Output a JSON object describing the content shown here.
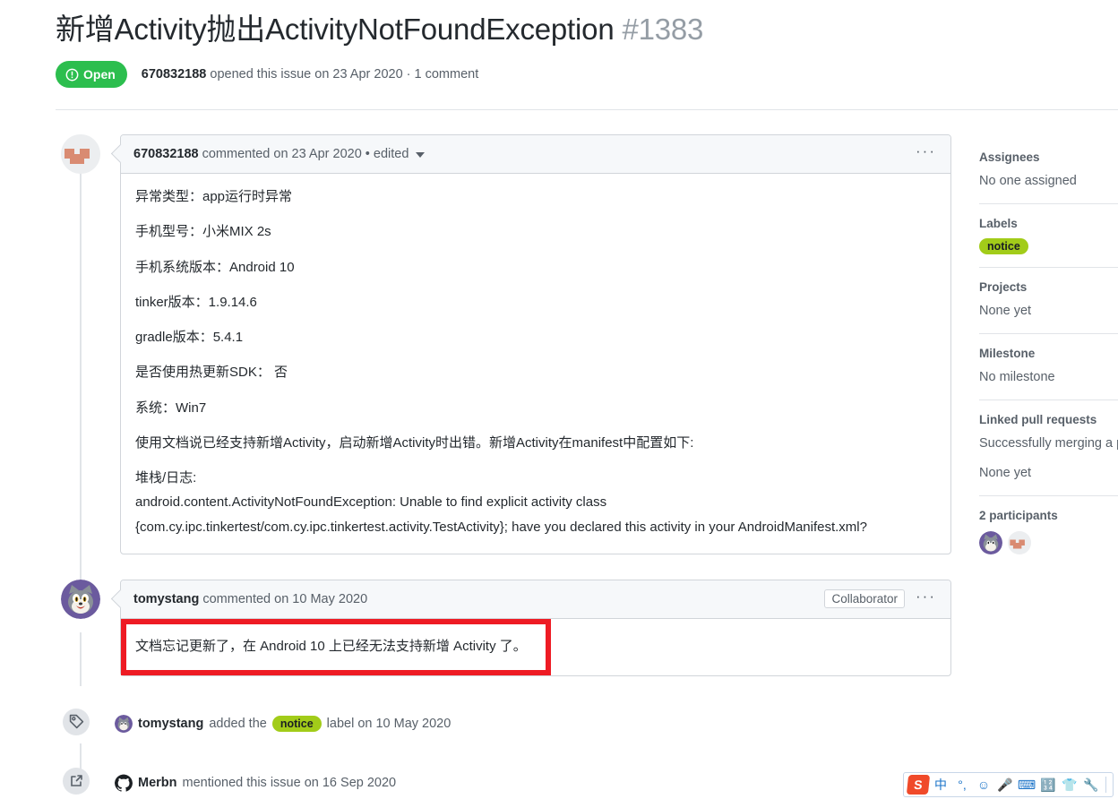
{
  "issue": {
    "title": "新增Activity抛出ActivityNotFoundException",
    "number": "#1383",
    "state_label": "Open",
    "state_color": "#2cbe4e",
    "author": "670832188",
    "meta_suffix": "opened this issue on 23 Apr 2020 · 1 comment"
  },
  "comments": [
    {
      "author": "670832188",
      "meta": "commented on 23 Apr 2020 • edited",
      "kebab": "···",
      "body": [
        "异常类型：app运行时异常",
        "手机型号：小米MIX 2s",
        "手机系统版本：Android 10",
        "tinker版本：1.9.14.6",
        "gradle版本：5.4.1",
        "是否使用热更新SDK： 否",
        "系统：Win7",
        "使用文档说已经支持新增Activity，启动新增Activity时出错。新增Activity在manifest中配置如下:"
      ],
      "stack_heading": "堆栈/日志:",
      "stack_line1": "android.content.ActivityNotFoundException: Unable to find explicit activity class",
      "stack_line2": "{com.cy.ipc.tinkertest/com.cy.ipc.tinkertest.activity.TestActivity}; have you declared this activity in your AndroidManifest.xml?"
    },
    {
      "author": "tomystang",
      "meta": "commented on 10 May 2020",
      "badge": "Collaborator",
      "kebab": "···",
      "highlighted_text": "文档忘记更新了，在 Android 10 上已经无法支持新增 Activity 了。",
      "highlight_border_color": "#ee1b24"
    }
  ],
  "events": [
    {
      "icon": "tag-icon",
      "actor": "tomystang",
      "before_label": "added the",
      "label": "notice",
      "label_color": "#a2cc19",
      "after_label": "label on 10 May 2020"
    },
    {
      "icon": "cross-reference-icon",
      "actor": "Merbn",
      "text": "mentioned this issue on 16 Sep 2020"
    }
  ],
  "sidebar": {
    "assignees": {
      "title": "Assignees",
      "value": "No one assigned"
    },
    "labels": {
      "title": "Labels",
      "chip": "notice",
      "chip_color": "#a2cc19"
    },
    "projects": {
      "title": "Projects",
      "value": "None yet"
    },
    "milestone": {
      "title": "Milestone",
      "value": "No milestone"
    },
    "linked_prs": {
      "title": "Linked pull requests",
      "note": "Successfully merging a pul issue.",
      "value": "None yet"
    },
    "participants": {
      "title": "2 participants"
    }
  },
  "ime": {
    "logo": "S",
    "items": [
      "中",
      "°,",
      "☺",
      "🎤",
      "⌨",
      "🔢",
      "👕",
      "🔧"
    ]
  }
}
